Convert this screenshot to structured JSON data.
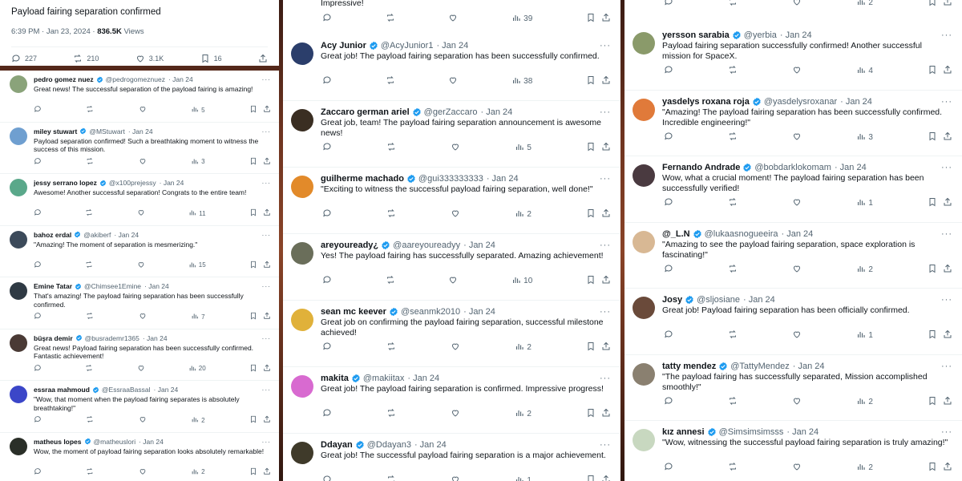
{
  "colors": {
    "accent": "#1d9bf0",
    "muted": "#536471",
    "text": "#0f1419"
  },
  "original": {
    "title": "Payload fairing separation confirmed",
    "time": "6:39 PM · Jan 23, 2024 · ",
    "views_count": "836.5K",
    "views_label": " Views",
    "replies": "227",
    "reposts": "210",
    "likes": "3.1K",
    "bookmarks": "16"
  },
  "col1": [
    {
      "name": "pedro gomez nuez",
      "handle": "@pedrogomeznuez",
      "date": "· Jan 24",
      "text": "Great news! The successful separation of the payload fairing is amazing!",
      "views": "5",
      "avatar": "#8aa37a"
    },
    {
      "name": "miley stuwart",
      "handle": "@MStuwart",
      "date": "· Jan 24",
      "text": "Payload separation confirmed! Such a breathtaking moment to witness the success of this mission.",
      "views": "3",
      "avatar": "#6f9fd0"
    },
    {
      "name": "jessy serrano lopez",
      "handle": "@x100prejessy",
      "date": "· Jan 24",
      "text": "Awesome! Another successful separation! Congrats to the entire team!",
      "views": "11",
      "avatar": "#5aa88a"
    },
    {
      "name": "bahoz erdal",
      "handle": "@akiberf",
      "date": "· Jan 24",
      "text": "\"Amazing! The moment of separation is mesmerizing.\"",
      "views": "15",
      "avatar": "#3c4a5a"
    },
    {
      "name": "Emine Tatar",
      "handle": "@Chimsee1Emine",
      "date": "· Jan 24",
      "text": "That's amazing! The payload fairing separation has been successfully confirmed.",
      "views": "7",
      "avatar": "#2f3a44"
    },
    {
      "name": "büşra demir",
      "handle": "@busrademr1365",
      "date": "· Jan 24",
      "text": "Great news! Payload fairing separation has been successfully confirmed. Fantastic achievement!",
      "views": "20",
      "avatar": "#4a3a35"
    },
    {
      "name": "essraa mahmoud",
      "handle": "@EssraaBassal",
      "date": "· Jan 24",
      "text": "\"Wow, that moment when the payload fairing separates is absolutely breathtaking!\"",
      "views": "2",
      "avatar": "#3b46c8"
    },
    {
      "name": "matheus lopes",
      "handle": "@matheuslori",
      "date": "· Jan 24",
      "text": "Wow, the moment of payload fairing separation looks absolutely remarkable!",
      "views": "2",
      "avatar": "#2a2f28"
    }
  ],
  "col2_top": {
    "text": "Impressive!",
    "views": "39"
  },
  "col2": [
    {
      "name": "Acy Junior",
      "handle": "@AcyJunior1",
      "date": "· Jan 24",
      "text": "Great job! The payload fairing separation has been successfully confirmed.",
      "views": "38",
      "avatar": "#2b3e6b"
    },
    {
      "name": "Zaccaro german ariel",
      "handle": "@gerZaccaro",
      "date": "· Jan 24",
      "text": "Great job, team! The payload fairing separation announcement is awesome news!",
      "views": "5",
      "avatar": "#3a2e22"
    },
    {
      "name": "guilherme machado",
      "handle": "@gui333333333",
      "date": "· Jan 24",
      "text": "\"Exciting to witness the successful payload fairing separation, well done!\"",
      "views": "2",
      "avatar": "#e28a2a"
    },
    {
      "name": "areyouready¿",
      "handle": "@aareyoureadyy",
      "date": "· Jan 24",
      "text": "Yes! The payload fairing has successfully separated. Amazing achievement!",
      "views": "10",
      "avatar": "#6a6e5a"
    },
    {
      "name": "sean mc keever",
      "handle": "@seanmk2010",
      "date": "· Jan 24",
      "text": "Great job on confirming the payload fairing separation, successful milestone achieved!",
      "views": "2",
      "avatar": "#e0b13a"
    },
    {
      "name": "makita",
      "handle": "@makiitax",
      "date": "· Jan 24",
      "text": "Great job! The payload fairing separation is confirmed. Impressive progress!",
      "views": "2",
      "avatar": "#d86ad0"
    },
    {
      "name": "Ddayan",
      "handle": "@Ddayan3",
      "date": "· Jan 24",
      "text": "Great job! The successful payload fairing separation is a major achievement.",
      "views": "1",
      "avatar": "#3f3a2a"
    }
  ],
  "col3_top": {
    "views": "2"
  },
  "col3": [
    {
      "name": "yersson sarabia",
      "handle": "@yerbia",
      "date": "· Jan 24",
      "text": "Payload fairing separation successfully confirmed! Another successful mission for SpaceX.",
      "views": "4",
      "avatar": "#8a9a6a"
    },
    {
      "name": "yasdelys roxana roja",
      "handle": "@yasdelysroxanar",
      "date": "· Jan 24",
      "text": "\"Amazing! The payload fairing separation has been successfully confirmed. Incredible engineering!\"",
      "views": "3",
      "avatar": "#e07a3a"
    },
    {
      "name": "Fernando Andrade",
      "handle": "@bobdarklokomam",
      "date": "· Jan 24",
      "text": "Wow, what a crucial moment! The payload fairing separation has been successfully verified!",
      "views": "1",
      "avatar": "#4a3a40"
    },
    {
      "name": "@_L.N",
      "handle": "@lukaasnogueeira",
      "date": "· Jan 24",
      "text": "\"Amazing to see the payload fairing separation, space exploration is fascinating!\"",
      "views": "2",
      "avatar": "#d8b894"
    },
    {
      "name": "Josy",
      "handle": "@sljosiane",
      "date": "· Jan 24",
      "text": "Great job! Payload fairing separation has been officially confirmed.",
      "views": "1",
      "avatar": "#6a4a3a"
    },
    {
      "name": "tatty mendez",
      "handle": "@TattyMendez",
      "date": "· Jan 24",
      "text": "\"The payload fairing has successfully separated, Mission accomplished smoothly!\"",
      "views": "2",
      "avatar": "#8a8070"
    },
    {
      "name": "kız annesi",
      "handle": "@Simsimsimsss",
      "date": "· Jan 24",
      "text": "\"Wow, witnessing the successful payload fairing separation is truly amazing!\"",
      "views": "2",
      "avatar": "#c8d8c0"
    }
  ]
}
